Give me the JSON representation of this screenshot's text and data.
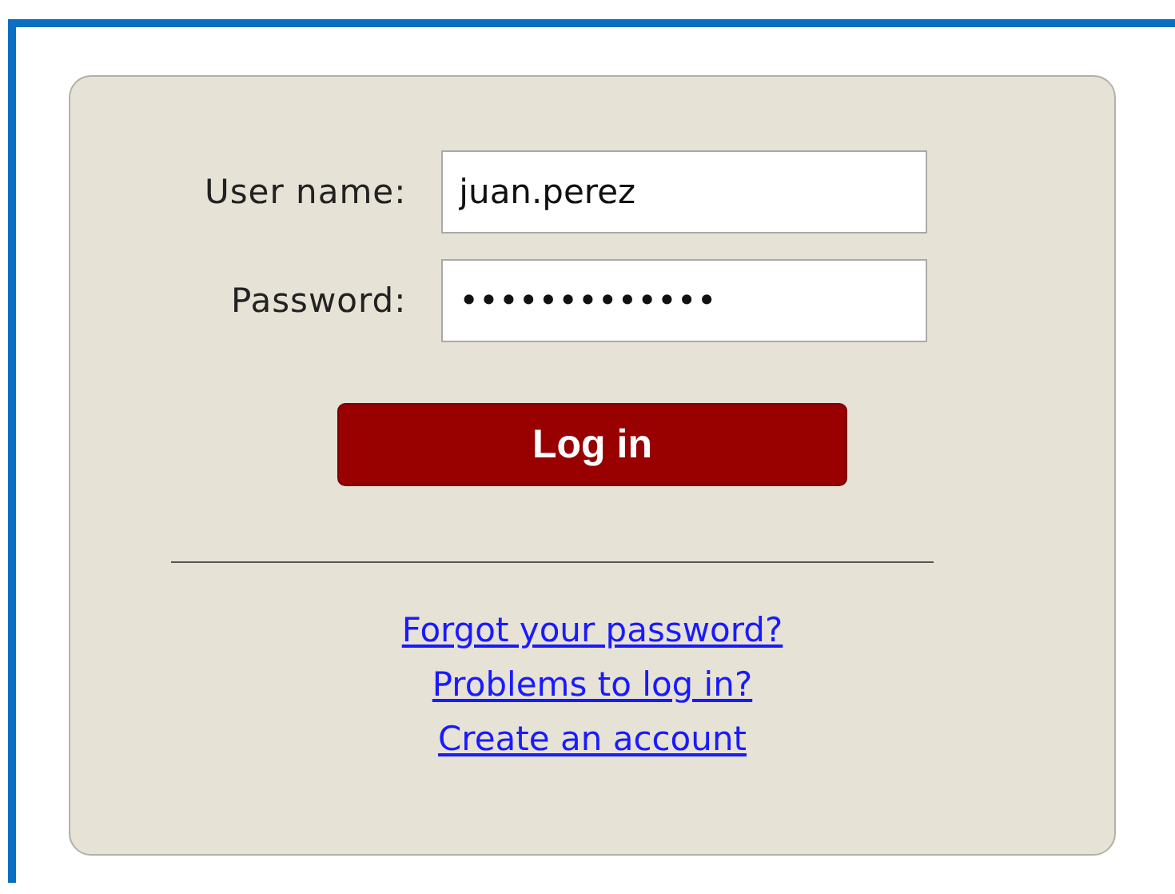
{
  "form": {
    "fields": [
      {
        "label": "User name:",
        "value": "juan.perez"
      },
      {
        "label": "Password:",
        "value": "•••••••••••••"
      }
    ],
    "button": "Log in",
    "links": [
      "Forgot your password?",
      "Problems to log in?",
      "Create an account"
    ]
  }
}
